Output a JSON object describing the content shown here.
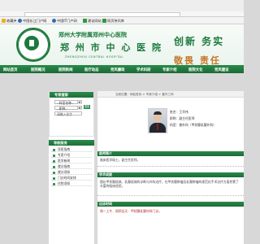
{
  "browser": {
    "favorites": [
      {
        "label": "收藏夹",
        "icon": "star-icon",
        "color": "#e8b21c"
      },
      {
        "label": "中国长江门户网",
        "icon": "globe-icon",
        "color": "#2d6fb7"
      },
      {
        "label": "中国IT门户网",
        "icon": "globe-icon",
        "color": "#2d6fb7"
      },
      {
        "label": "建议网站",
        "icon": "web-slice-icon",
        "color": "#2f9a3f"
      },
      {
        "label": "网页快讯库",
        "icon": "web-slice-icon",
        "color": "#2f9a3f"
      }
    ]
  },
  "header": {
    "hospital_name_small": "郑州大学附属郑州中心医院",
    "hospital_name_big": "郑 州 市 中 心 医 院",
    "hospital_name_en": "ZHENGZHOU CENTRAL HOSPITAL",
    "slogan_top": "创新  务实",
    "slogan_bottom": "敬畏  责任"
  },
  "nav": {
    "items": [
      "网站首页",
      "医院概况",
      "医院新闻",
      "医疗动态",
      "党风廉政",
      "学术科研",
      "专家介绍",
      "医院文化",
      "党风建设"
    ]
  },
  "sidebar": {
    "search_title": "专家搜索",
    "dept_select": "--科室名称--",
    "title_select": "--职称--",
    "name_input": "请输入名字",
    "go_button": "搜索",
    "nav_title": "导航服务",
    "menu_items": [
      "导医指南",
      "专家介绍",
      "医学新闻",
      "就诊指南",
      "就诊须知",
      "门诊时间安排",
      "住院须知"
    ]
  },
  "content": {
    "breadcrumb": "当前位置：网站首页 > 专家介绍 > 普外三科",
    "doctor_name": "姓名：王华伟",
    "doctor_title": "职称：副主任医师",
    "doctor_dept": "科室：普外科（甲状腺乳腺外科）",
    "sec_intro": "医师简介",
    "intro_text": "临床医学硕士，副主任医师。",
    "sec_specialty": "学术成就",
    "specialty_text": "擅长甲状腺疾病、乳腺疾病的诊断与外科治疗，在甲状腺肿瘤及乳腺肿瘤的规范化手术治疗方面积累了丰富的临床经验。",
    "sec_schedule": "出诊时间",
    "schedule_text": "周一上午、周四全天：甲状腺乳腺外科门诊。"
  }
}
